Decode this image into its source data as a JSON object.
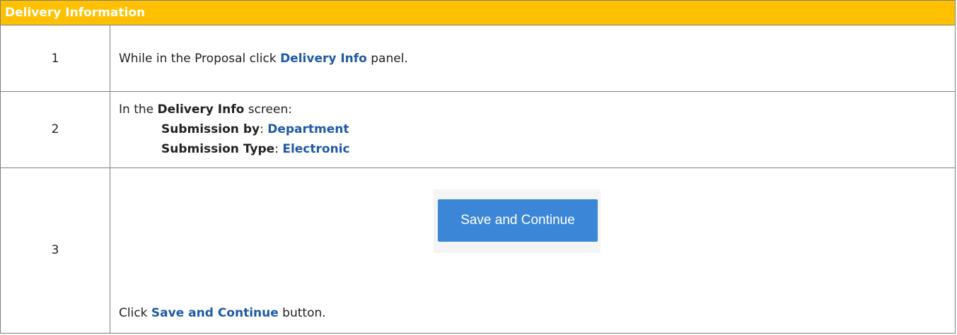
{
  "header": {
    "title": "Delivery Information"
  },
  "steps": [
    {
      "number": "1",
      "lines": [
        {
          "text_before": "While in the Proposal click ",
          "link": "Delivery Info",
          "text_after": " panel."
        }
      ]
    },
    {
      "number": "2",
      "intro": {
        "text_before": "In the ",
        "bold": "Delivery Info",
        "text_after": " screen:"
      },
      "fields": [
        {
          "label": "Submission by",
          "separator": ": ",
          "value": "Department"
        },
        {
          "label": "Submission Type",
          "separator": ": ",
          "value": "Electronic"
        }
      ]
    },
    {
      "number": "3",
      "instruction": {
        "text_before": "Click ",
        "link": "Save and Continue",
        "text_after": " button."
      },
      "button_label": "Save and Continue"
    }
  ],
  "colors": {
    "header_bg": "#ffc000",
    "link": "#1f5aa6",
    "button_bg": "#3c86d8"
  }
}
